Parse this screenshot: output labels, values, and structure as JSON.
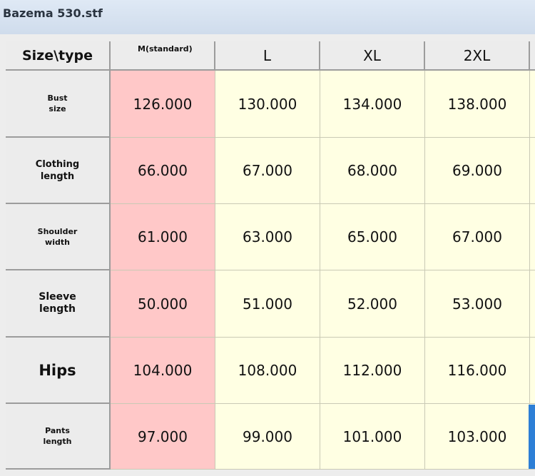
{
  "window": {
    "title": "Bazema 530.stf"
  },
  "table": {
    "corner_label": "Size\\type",
    "columns": [
      {
        "label_top": "M",
        "label_bottom": "(standard)"
      },
      {
        "label": "L"
      },
      {
        "label": "XL"
      },
      {
        "label": "2XL"
      }
    ],
    "rows": [
      {
        "label_line1": "Bust",
        "label_line2": "size",
        "values": [
          "126.000",
          "130.000",
          "134.000",
          "138.000"
        ]
      },
      {
        "label_line1": "Clothing",
        "label_line2": "length",
        "values": [
          "66.000",
          "67.000",
          "68.000",
          "69.000"
        ]
      },
      {
        "label_line1": "Shoulder",
        "label_line2": "width",
        "values": [
          "61.000",
          "63.000",
          "65.000",
          "67.000"
        ]
      },
      {
        "label_line1": "Sleeve",
        "label_line2": "length",
        "values": [
          "50.000",
          "51.000",
          "52.000",
          "53.000"
        ]
      },
      {
        "label_line1": "Hips",
        "label_line2": "",
        "values": [
          "104.000",
          "108.000",
          "112.000",
          "116.000"
        ]
      },
      {
        "label_line1": "Pants",
        "label_line2": "length",
        "values": [
          "97.000",
          "99.000",
          "101.000",
          "103.000"
        ]
      }
    ],
    "highlight_color": "#ffc8c8",
    "cell_color": "#ffffe3"
  }
}
